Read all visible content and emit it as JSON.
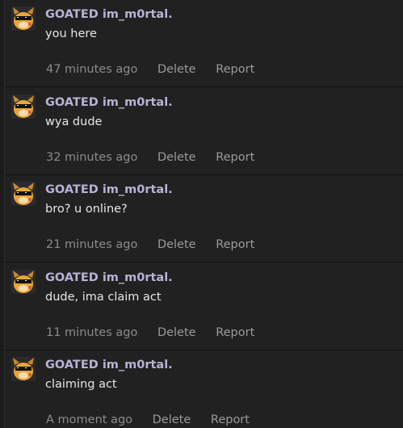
{
  "messages": [
    {
      "username": "GOATED im_m0rtal.",
      "text": "you here",
      "time": "47 minutes ago",
      "delete_label": "Delete",
      "report_label": "Report"
    },
    {
      "username": "GOATED im_m0rtal.",
      "text": "wya dude",
      "time": "32 minutes ago",
      "delete_label": "Delete",
      "report_label": "Report"
    },
    {
      "username": "GOATED im_m0rtal.",
      "text": "bro? u online?",
      "time": "21 minutes ago",
      "delete_label": "Delete",
      "report_label": "Report"
    },
    {
      "username": "GOATED im_m0rtal.",
      "text": "dude, ima claim act",
      "time": "11 minutes ago",
      "delete_label": "Delete",
      "report_label": "Report"
    },
    {
      "username": "GOATED im_m0rtal.",
      "text": "claiming act",
      "time": "A moment ago",
      "delete_label": "Delete",
      "report_label": "Report"
    }
  ],
  "avatar_icon": "sunglasses-character-icon",
  "colors": {
    "background": "#212121",
    "username": "#b9b2d4",
    "message_text": "#e6e6e6",
    "meta_text": "#8b8b8b"
  }
}
